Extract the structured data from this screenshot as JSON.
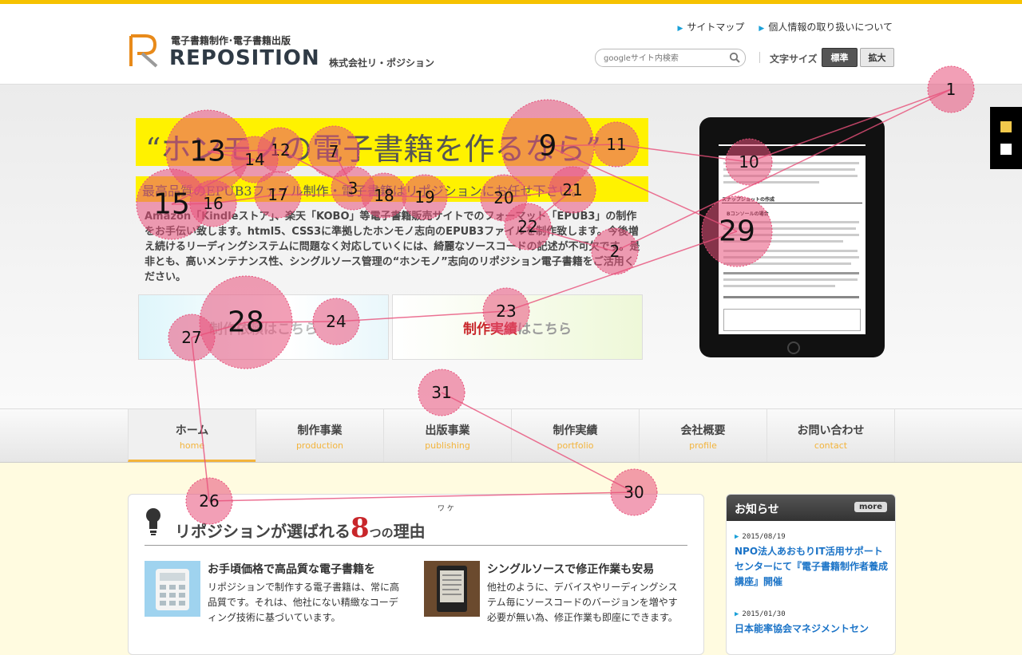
{
  "header": {
    "logo_tagline": "電子書籍制作･電子書籍出版",
    "logo_name": "REPOSITION",
    "company_name": "株式会社リ・ポジション",
    "links": [
      {
        "label": "サイトマップ"
      },
      {
        "label": "個人情報の取り扱いについて"
      }
    ],
    "search_placeholder": "googleサイト内検索",
    "font_size_label": "文字サイズ",
    "font_size_normal": "標準",
    "font_size_large": "拡大"
  },
  "hero": {
    "headline": "“ホンモノの電子書籍を作るなら”",
    "subheadline": "最高品質のEPUB3ファイル制作・電子書籍はリポジションにお任せ下さい。",
    "body": "Amazon「Kindleストア」、楽天「KOBO」等電子書籍販売サイトでのフォーマット「EPUB3」の制作をお手伝い致します。html5、CSS3に準拠したホンモノ志向のEPUB3ファイルを制作致します。今後増え続けるリーディングシステムに問題なく対応していくには、綺麗なソースコードの記述が不可欠です。是非とも、高いメンテナンス性、シングルソース管理の“ホンモノ”志向のリポジション電子書籍をご活用ください。",
    "btn_order": "制作依頼はこちら",
    "btn_works_em": "制作実績",
    "btn_works_rest": "はこちら",
    "tablet_heading": "スナップショットの作成",
    "tablet_subheading": "Bコンソールの場合"
  },
  "nav": [
    {
      "ja": "ホーム",
      "en": "home"
    },
    {
      "ja": "制作事業",
      "en": "production"
    },
    {
      "ja": "出版事業",
      "en": "publishing"
    },
    {
      "ja": "制作実績",
      "en": "portfolio"
    },
    {
      "ja": "会社概要",
      "en": "profile"
    },
    {
      "ja": "お問い合わせ",
      "en": "contact"
    }
  ],
  "reasons": {
    "title_pre": "リポジションが選ばれる",
    "title_num": "8",
    "title_mid": "つの",
    "title_post": "理由",
    "ruby": "ワ ケ",
    "items": [
      {
        "title": "お手頃価格で高品質な電子書籍を",
        "body": "リポジションで制作する電子書籍は、常に高品質です。それは、他社にない精緻なコーディング技術に基づいています。"
      },
      {
        "title": "シングルソースで修正作業も安易",
        "body": "他社のように、デバイスやリーディングシステム毎にソースコードのバージョンを増やす必要が無い為、修正作業も即座にできます。"
      }
    ]
  },
  "news": {
    "title": "お知らせ",
    "more": "more",
    "items": [
      {
        "date": "2015/08/19",
        "text": "NPO法人あおもりIT活用サポートセンターにて『電子書籍制作者養成講座』開催"
      },
      {
        "date": "2015/01/30",
        "text": "日本能率協会マネジメントセン"
      }
    ]
  },
  "gaze_labels": [
    "1",
    "2",
    "3",
    "7",
    "9",
    "10",
    "11",
    "12",
    "13",
    "14",
    "15",
    "16",
    "17",
    "18",
    "19",
    "20",
    "21",
    "22",
    "23",
    "24",
    "26",
    "27",
    "28",
    "29",
    "30",
    "31"
  ],
  "colors": {
    "accent": "#f6c200",
    "highlight": "#fff200",
    "link": "#1a73c7",
    "gaze": "#e8507a"
  }
}
